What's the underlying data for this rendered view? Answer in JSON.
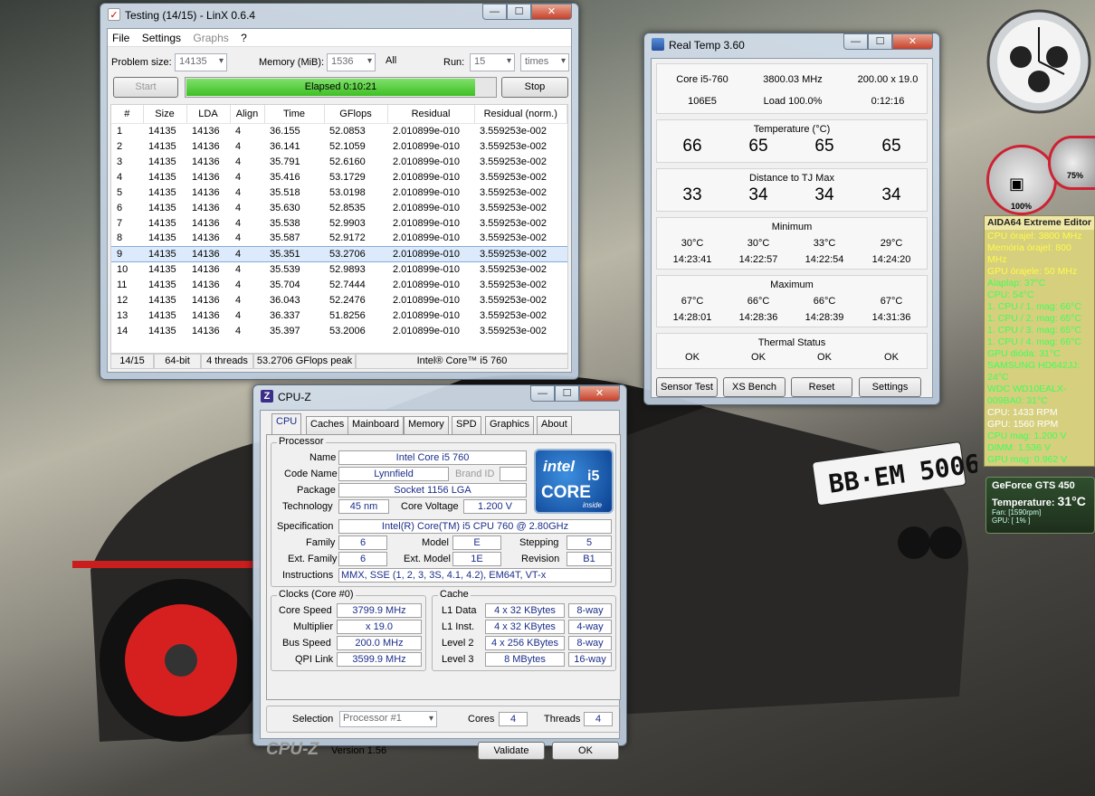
{
  "linx": {
    "title": "Testing (14/15) - LinX 0.6.4",
    "menu": [
      "File",
      "Settings",
      "Graphs",
      "?"
    ],
    "problem_size_label": "Problem size:",
    "problem_size": "14135",
    "memory_label": "Memory (MiB):",
    "memory": "1536",
    "all_label": "All",
    "run_label": "Run:",
    "run": "15",
    "run_unit": "times",
    "start": "Start",
    "elapsed": "Elapsed 0:10:21",
    "progress": 0.93,
    "stop": "Stop",
    "columns": [
      "#",
      "Size",
      "LDA",
      "Align",
      "Time",
      "GFlops",
      "Residual",
      "Residual (norm.)"
    ],
    "rows": [
      [
        "1",
        "14135",
        "14136",
        "4",
        "36.155",
        "52.0853",
        "2.010899e-010",
        "3.559253e-002"
      ],
      [
        "2",
        "14135",
        "14136",
        "4",
        "36.141",
        "52.1059",
        "2.010899e-010",
        "3.559253e-002"
      ],
      [
        "3",
        "14135",
        "14136",
        "4",
        "35.791",
        "52.6160",
        "2.010899e-010",
        "3.559253e-002"
      ],
      [
        "4",
        "14135",
        "14136",
        "4",
        "35.416",
        "53.1729",
        "2.010899e-010",
        "3.559253e-002"
      ],
      [
        "5",
        "14135",
        "14136",
        "4",
        "35.518",
        "53.0198",
        "2.010899e-010",
        "3.559253e-002"
      ],
      [
        "6",
        "14135",
        "14136",
        "4",
        "35.630",
        "52.8535",
        "2.010899e-010",
        "3.559253e-002"
      ],
      [
        "7",
        "14135",
        "14136",
        "4",
        "35.538",
        "52.9903",
        "2.010899e-010",
        "3.559253e-002"
      ],
      [
        "8",
        "14135",
        "14136",
        "4",
        "35.587",
        "52.9172",
        "2.010899e-010",
        "3.559253e-002"
      ],
      [
        "9",
        "14135",
        "14136",
        "4",
        "35.351",
        "53.2706",
        "2.010899e-010",
        "3.559253e-002"
      ],
      [
        "10",
        "14135",
        "14136",
        "4",
        "35.539",
        "52.9893",
        "2.010899e-010",
        "3.559253e-002"
      ],
      [
        "11",
        "14135",
        "14136",
        "4",
        "35.704",
        "52.7444",
        "2.010899e-010",
        "3.559253e-002"
      ],
      [
        "12",
        "14135",
        "14136",
        "4",
        "36.043",
        "52.2476",
        "2.010899e-010",
        "3.559253e-002"
      ],
      [
        "13",
        "14135",
        "14136",
        "4",
        "36.337",
        "51.8256",
        "2.010899e-010",
        "3.559253e-002"
      ],
      [
        "14",
        "14135",
        "14136",
        "4",
        "35.397",
        "53.2006",
        "2.010899e-010",
        "3.559253e-002"
      ]
    ],
    "status": [
      "14/15",
      "64-bit",
      "4 threads",
      "53.2706 GFlops peak",
      "Intel® Core™ i5 760"
    ]
  },
  "realtemp": {
    "title": "Real Temp 3.60",
    "info": [
      "Core i5-760",
      "3800.03 MHz",
      "200.00 x 19.0",
      "106E5",
      "Load 100.0%",
      "0:12:16"
    ],
    "temp_label": "Temperature (°C)",
    "temps": [
      "66",
      "65",
      "65",
      "65"
    ],
    "dist_label": "Distance to TJ Max",
    "dist": [
      "33",
      "34",
      "34",
      "34"
    ],
    "min_label": "Minimum",
    "min_t": [
      "30°C",
      "30°C",
      "33°C",
      "29°C"
    ],
    "min_time": [
      "14:23:41",
      "14:22:57",
      "14:22:54",
      "14:24:20"
    ],
    "max_label": "Maximum",
    "max_t": [
      "67°C",
      "66°C",
      "66°C",
      "67°C"
    ],
    "max_time": [
      "14:28:01",
      "14:28:36",
      "14:28:39",
      "14:31:36"
    ],
    "thermal_label": "Thermal Status",
    "thermal": [
      "OK",
      "OK",
      "OK",
      "OK"
    ],
    "buttons": [
      "Sensor Test",
      "XS Bench",
      "Reset",
      "Settings"
    ]
  },
  "cpuz": {
    "title": "CPU-Z",
    "tabs": [
      "CPU",
      "Caches",
      "Mainboard",
      "Memory",
      "SPD",
      "Graphics",
      "About"
    ],
    "processor_label": "Processor",
    "name_l": "Name",
    "name": "Intel Core i5 760",
    "codename_l": "Code Name",
    "codename": "Lynnfield",
    "brandid_l": "Brand ID",
    "package_l": "Package",
    "package": "Socket 1156 LGA",
    "tech_l": "Technology",
    "tech": "45 nm",
    "voltage_l": "Core Voltage",
    "voltage": "1.200 V",
    "spec_l": "Specification",
    "spec": "Intel(R) Core(TM) i5 CPU       760  @ 2.80GHz",
    "family_l": "Family",
    "family": "6",
    "model_l": "Model",
    "model": "E",
    "stepping_l": "Stepping",
    "stepping": "5",
    "extfamily_l": "Ext. Family",
    "extfamily": "6",
    "extmodel_l": "Ext. Model",
    "extmodel": "1E",
    "revision_l": "Revision",
    "revision": "B1",
    "instr_l": "Instructions",
    "instr": "MMX, SSE (1, 2, 3, 3S, 4.1, 4.2), EM64T, VT-x",
    "clocks_label": "Clocks (Core #0)",
    "corespeed_l": "Core Speed",
    "corespeed": "3799.9 MHz",
    "mult_l": "Multiplier",
    "mult": "x 19.0",
    "bus_l": "Bus Speed",
    "bus": "200.0 MHz",
    "qpi_l": "QPI Link",
    "qpi": "3599.9 MHz",
    "cache_label": "Cache",
    "l1d_l": "L1 Data",
    "l1d": "4 x 32 KBytes",
    "l1d_w": "8-way",
    "l1i_l": "L1 Inst.",
    "l1i": "4 x 32 KBytes",
    "l1i_w": "4-way",
    "l2_l": "Level 2",
    "l2": "4 x 256 KBytes",
    "l2_w": "8-way",
    "l3_l": "Level 3",
    "l3": "8 MBytes",
    "l3_w": "16-way",
    "selection_l": "Selection",
    "selection": "Processor #1",
    "cores_l": "Cores",
    "cores": "4",
    "threads_l": "Threads",
    "threads": "4",
    "brand": "CPU-Z",
    "version": "Version 1.56",
    "validate": "Validate",
    "ok": "OK",
    "logo": {
      "intel": "intel",
      "core": "CORE",
      "i5": "i5",
      "inside": "inside"
    }
  },
  "aida": {
    "title": "AIDA64 Extreme Editor",
    "lines": [
      {
        "t": "CPU órajel: 3800 MHz",
        "c": "y"
      },
      {
        "t": "Memória órajel: 800 MHz",
        "c": "y"
      },
      {
        "t": "GPU órajele: 50 MHz",
        "c": "y"
      },
      {
        "t": "Alaplap: 37°C",
        "c": "g"
      },
      {
        "t": "CPU: 54°C",
        "c": "g"
      },
      {
        "t": "1. CPU / 1. mag: 66°C",
        "c": "g"
      },
      {
        "t": "1. CPU / 2. mag: 65°C",
        "c": "g"
      },
      {
        "t": "1. CPU / 3. mag: 65°C",
        "c": "g"
      },
      {
        "t": "1. CPU / 4. mag: 66°C",
        "c": "g"
      },
      {
        "t": "GPU dióda: 31°C",
        "c": "g"
      },
      {
        "t": "SAMSUNG HD642JJ: 24°C",
        "c": "g"
      },
      {
        "t": "WDC WD10EALX-009BA0: 31°C",
        "c": "g"
      },
      {
        "t": "CPU: 1433 RPM",
        "c": "w"
      },
      {
        "t": "GPU: 1560 RPM",
        "c": "w"
      },
      {
        "t": "CPU mag: 1.200 V",
        "c": "g"
      },
      {
        "t": "DIMM: 1.536 V",
        "c": "g"
      },
      {
        "t": "GPU mag: 0.962 V",
        "c": "g"
      }
    ]
  },
  "gpu_gadget": {
    "title": "GeForce GTS 450",
    "temp_label": "Temperature:",
    "temp": "31°C",
    "fan": "Fan: [1590rpm]",
    "gpu": "GPU: [ 1% ]"
  },
  "meters": {
    "cpu": "100%",
    "mem": "75%"
  },
  "plate": "BB·EM 5006"
}
